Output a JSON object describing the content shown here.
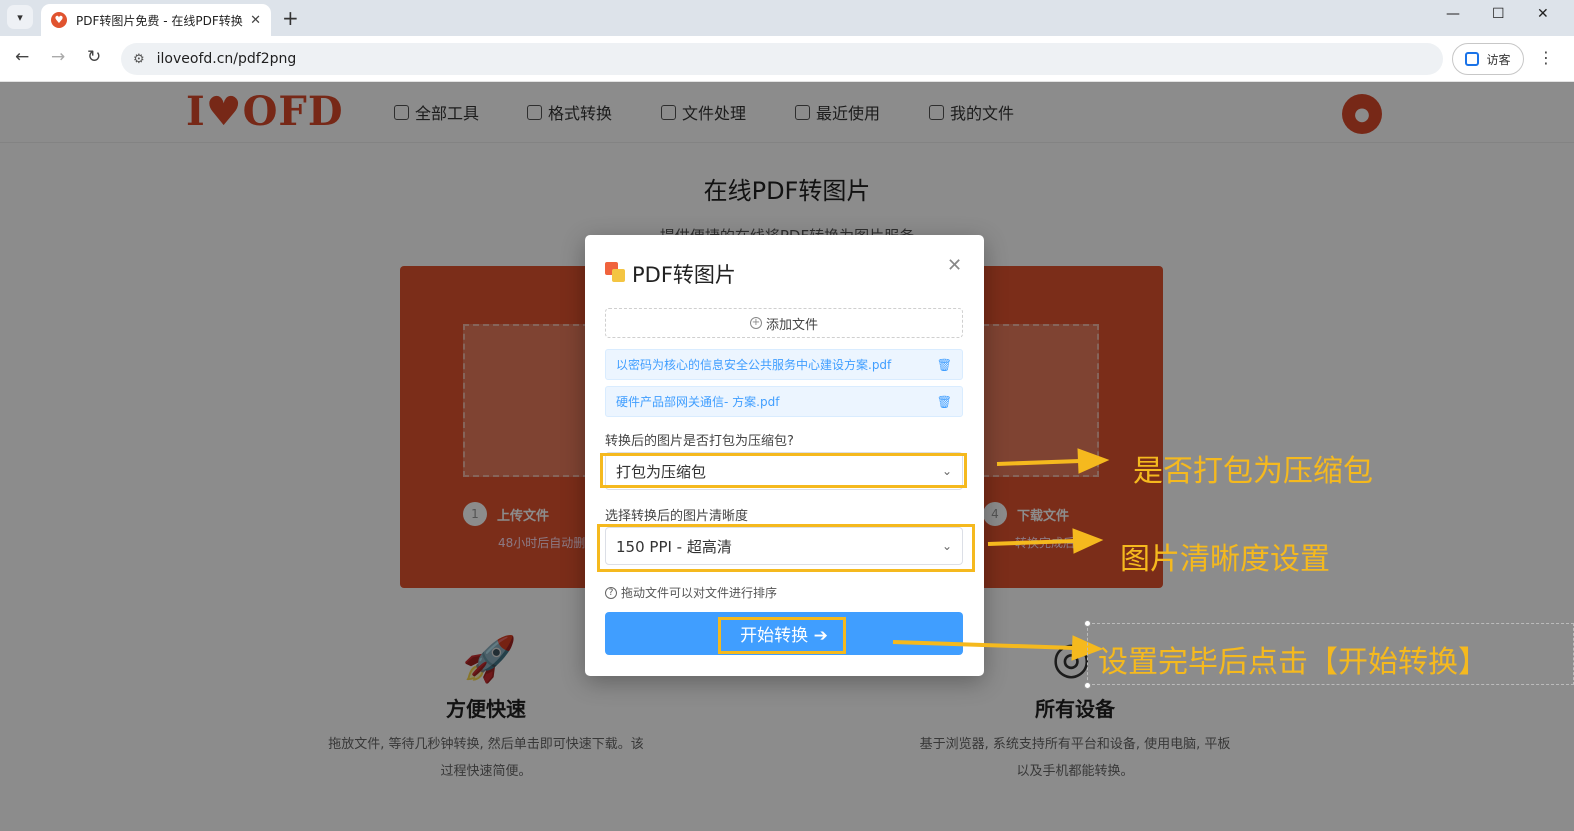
{
  "browser": {
    "tab_title": "PDF转图片免费 - 在线PDF转换",
    "url": "iloveofd.cn/pdf2png",
    "guest_label": "访客"
  },
  "site": {
    "logo": "I♥OFD",
    "nav": [
      "全部工具",
      "格式转换",
      "文件处理",
      "最近使用",
      "我的文件"
    ],
    "heading": "在线PDF转图片",
    "subheading": "提供便捷的在线将PDF转换为图片服务",
    "steps": [
      {
        "num": "1",
        "label": "上传文件",
        "note": "48小时后自动删"
      },
      {
        "num": "4",
        "label": "下载文件",
        "note": "转换完成后"
      }
    ],
    "features": [
      {
        "title": "方便快速",
        "desc": "拖放文件, 等待几秒钟转换, 然后单击即可快速下载。该过程快速简便。"
      },
      {
        "title": "所有设备",
        "desc": "基于浏览器, 系统支持所有平台和设备, 使用电脑, 平板以及手机都能转换。"
      }
    ]
  },
  "modal": {
    "title": "PDF转图片",
    "add_file": "添加文件",
    "files": [
      "以密码为核心的信息安全公共服务中心建设方案.pdf",
      "硬件产品部网关通信- 方案.pdf"
    ],
    "zip_label": "转换后的图片是否打包为压缩包?",
    "zip_value": "打包为压缩包",
    "quality_label": "选择转换后的图片清晰度",
    "quality_value": "150 PPI - 超高清",
    "hint": "拖动文件可以对文件进行排序",
    "start_button": "开始转换 ➔"
  },
  "annotations": {
    "zip": "是否打包为压缩包",
    "quality": "图片清晰度设置",
    "start": "设置完毕后点击【开始转换】",
    "color": "#f5b91e"
  }
}
